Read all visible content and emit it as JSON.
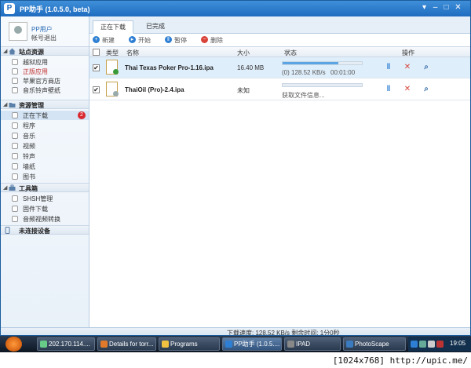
{
  "window": {
    "title": "PP助手 (1.0.5.0, beta)",
    "logo_letter": "P",
    "skin_glyph": "▾",
    "min_glyph": "–",
    "max_glyph": "□",
    "close_glyph": "✕"
  },
  "user": {
    "name": "PP用户",
    "action": "帐号退出"
  },
  "sidebar": {
    "sections": [
      {
        "label": "站点资源",
        "icon": "home-icon",
        "items": [
          {
            "label": "越狱应用",
            "icon": "app-icon"
          },
          {
            "label": "正版应用",
            "icon": "app-icon",
            "highlight": true
          },
          {
            "label": "苹果官方商店",
            "icon": "store-icon"
          },
          {
            "label": "音乐铃声壁纸",
            "icon": "music-icon"
          }
        ]
      },
      {
        "label": "资源管理",
        "icon": "folder-icon",
        "items": [
          {
            "label": "正在下载",
            "icon": "download-icon",
            "selected": true,
            "badge": "2"
          },
          {
            "label": "程序",
            "icon": "app-icon"
          },
          {
            "label": "音乐",
            "icon": "music-icon"
          },
          {
            "label": "视频",
            "icon": "video-icon"
          },
          {
            "label": "铃声",
            "icon": "bell-icon"
          },
          {
            "label": "墙纸",
            "icon": "image-icon"
          },
          {
            "label": "图书",
            "icon": "book-icon"
          }
        ]
      },
      {
        "label": "工具箱",
        "icon": "toolbox-icon",
        "items": [
          {
            "label": "SHSH管理",
            "icon": "key-icon"
          },
          {
            "label": "固件下载",
            "icon": "firmware-icon"
          },
          {
            "label": "音频视频转换",
            "icon": "convert-icon"
          }
        ]
      },
      {
        "label": "未连接设备",
        "icon": "device-icon",
        "items": []
      }
    ]
  },
  "tabs": [
    "正在下载",
    "已完成"
  ],
  "toolbar": {
    "new_label": "新建",
    "start_label": "开始",
    "pause_label": "暂停",
    "delete_label": "删除",
    "new_glyph": "+",
    "start_glyph": "▸",
    "pause_glyph": "‖",
    "delete_glyph": "−"
  },
  "table": {
    "columns": [
      "类型",
      "名称",
      "大小",
      "状态",
      "操作"
    ],
    "rows": [
      {
        "name": "Thai Texas Poker Pro-1.16.ipa",
        "size": "16.40 MB",
        "progress": 0.7,
        "speed": "(0) 128.52 KB/s",
        "time": "00:01:00",
        "checked": "✔"
      },
      {
        "name": "ThaiOil (Pro)-2.4.ipa",
        "size": "未知",
        "progress": 0,
        "speed": "获取文件信息...",
        "time": "",
        "checked": "✔"
      }
    ],
    "action_glyphs": {
      "pause": "‖",
      "delete": "✕",
      "search": "⌕"
    }
  },
  "status": {
    "text": "下载速度: 128.52 KB/s   剩余时间: 1分0秒"
  },
  "taskbar": {
    "items": [
      "202.170.114....",
      "Details for torr...",
      "Programs",
      "PP助手 (1.0.5....",
      "IPAD",
      "PhotoScape"
    ],
    "clock": "19:05"
  },
  "footer": {
    "text": "[1024x768] http://upic.me/"
  },
  "colors": {
    "accent": "#1f6cc0",
    "selected_row": "#dfeefb",
    "badge": "#d9282f",
    "progress": "#5ba5e4"
  }
}
